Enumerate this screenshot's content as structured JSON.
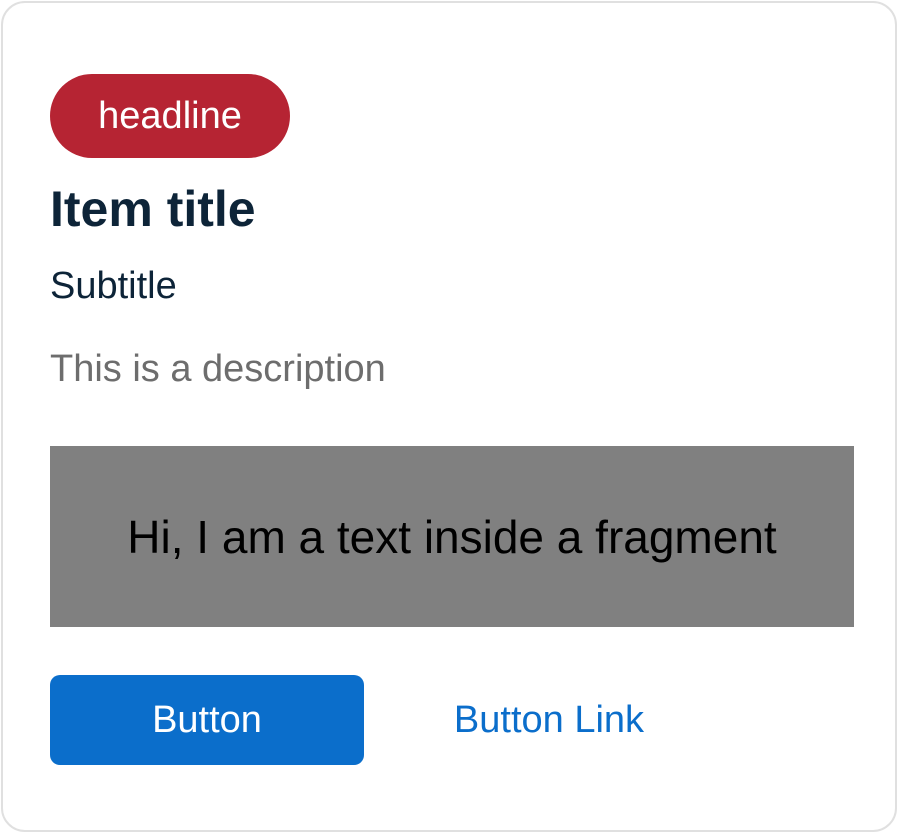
{
  "card": {
    "headline": "headline",
    "title": "Item title",
    "subtitle": "Subtitle",
    "description": "This is a description",
    "fragment_text": "Hi, I am a text inside a fragment",
    "primary_button_label": "Button",
    "link_button_label": "Button Link"
  },
  "colors": {
    "headline_badge": "#b62433",
    "title_text": "#0d2438",
    "description_text": "#6d6d6d",
    "fragment_background": "#808080",
    "accent": "#0b6ecb",
    "card_border": "#e0e0e0"
  }
}
